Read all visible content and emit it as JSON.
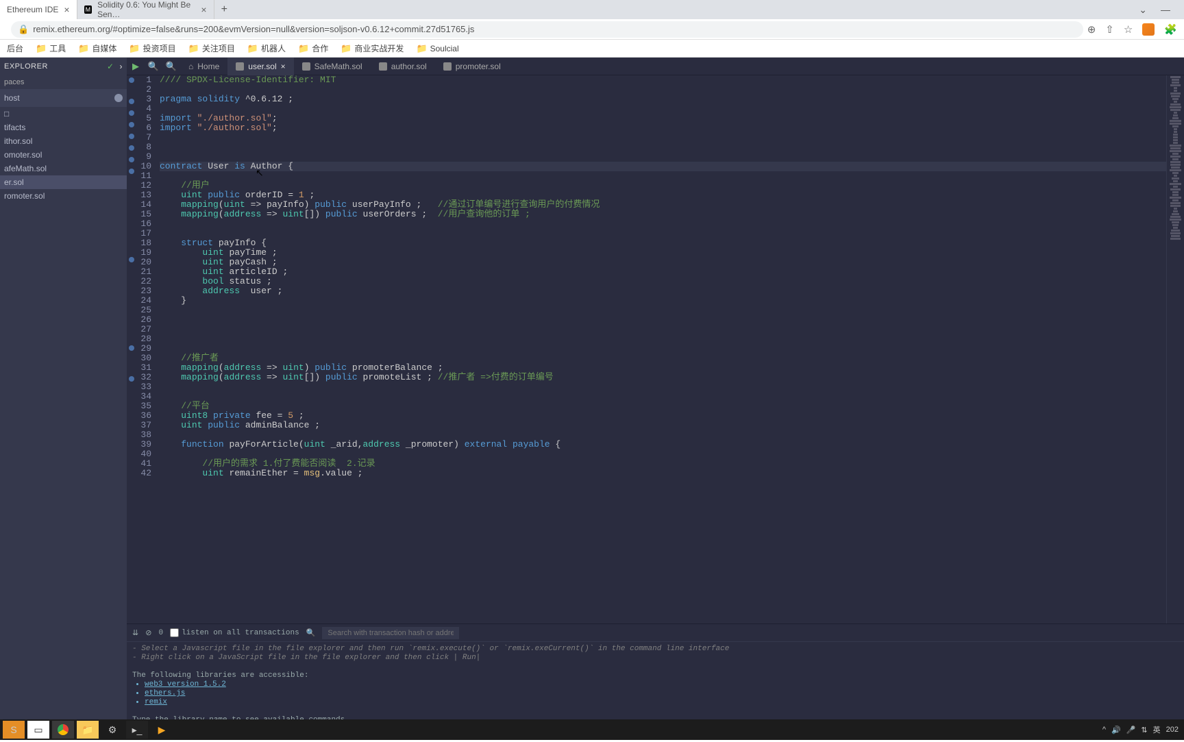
{
  "browser": {
    "tabs": [
      {
        "title": "Ethereum IDE",
        "active": true
      },
      {
        "title": "Solidity 0.6: You Might Be Sen…",
        "active": false
      }
    ],
    "url": "remix.ethereum.org/#optimize=false&runs=200&evmVersion=null&version=soljson-v0.6.12+commit.27d51765.js",
    "bookmarks": [
      "后台",
      "工具",
      "自媒体",
      "投资项目",
      "关注项目",
      "机器人",
      "合作",
      "商业实战开发",
      "Soulcial"
    ]
  },
  "sidebar": {
    "title": "EXPLORER",
    "workspaces": "paces",
    "host": "host",
    "files": [
      "□",
      "tifacts",
      "ithor.sol",
      "omoter.sol",
      "afeMath.sol",
      "er.sol",
      "romoter.sol"
    ],
    "selected_index": 5
  },
  "editor": {
    "tabs": [
      {
        "label": "Home",
        "icon": "home"
      },
      {
        "label": "user.sol",
        "icon": "sol",
        "active": true,
        "closable": true
      },
      {
        "label": "SafeMath.sol",
        "icon": "sol"
      },
      {
        "label": "author.sol",
        "icon": "sol"
      },
      {
        "label": "promoter.sol",
        "icon": "sol"
      }
    ],
    "breakpoints": [
      1,
      3,
      4,
      5,
      6,
      7,
      8,
      9,
      18,
      27,
      30
    ],
    "highlighted_line": 10
  },
  "code": [
    {
      "n": 1,
      "t": [
        [
          "cm",
          "//// SPDX-License-Identifier: MIT"
        ]
      ]
    },
    {
      "n": 2,
      "t": []
    },
    {
      "n": 3,
      "t": [
        [
          "kw",
          "pragma"
        ],
        [
          "",
          ""
        ],
        [
          "kw",
          " solidity"
        ],
        [
          "",
          " ^0.6.12 ;"
        ]
      ]
    },
    {
      "n": 4,
      "t": []
    },
    {
      "n": 5,
      "t": [
        [
          "kw",
          "import"
        ],
        [
          "",
          " "
        ],
        [
          "st",
          "\"./author.sol\""
        ],
        [
          "",
          ";"
        ]
      ]
    },
    {
      "n": 6,
      "t": [
        [
          "kw",
          "import"
        ],
        [
          "",
          " "
        ],
        [
          "st",
          "\"./author.sol\""
        ],
        [
          "",
          ";"
        ]
      ]
    },
    {
      "n": 7,
      "t": []
    },
    {
      "n": 8,
      "t": []
    },
    {
      "n": 9,
      "t": []
    },
    {
      "n": 10,
      "t": [
        [
          "kw",
          "contract"
        ],
        [
          "",
          " User "
        ],
        [
          "kw",
          "is"
        ],
        [
          "",
          " Author {"
        ]
      ]
    },
    {
      "n": 11,
      "t": []
    },
    {
      "n": 12,
      "t": [
        [
          "",
          "    "
        ],
        [
          "cm",
          "//用户"
        ]
      ]
    },
    {
      "n": 13,
      "t": [
        [
          "",
          "    "
        ],
        [
          "ty",
          "uint"
        ],
        [
          "",
          " "
        ],
        [
          "kw",
          "public"
        ],
        [
          "",
          " orderID = "
        ],
        [
          "nm",
          "1"
        ],
        [
          "",
          " ;"
        ]
      ]
    },
    {
      "n": 14,
      "t": [
        [
          "",
          "    "
        ],
        [
          "ty",
          "mapping"
        ],
        [
          "",
          "("
        ],
        [
          "ty",
          "uint"
        ],
        [
          "",
          " => payInfo) "
        ],
        [
          "kw",
          "public"
        ],
        [
          "",
          " userPayInfo ;   "
        ],
        [
          "cm",
          "//通过订单编号进行查询用户的付费情况"
        ]
      ]
    },
    {
      "n": 15,
      "t": [
        [
          "",
          "    "
        ],
        [
          "ty",
          "mapping"
        ],
        [
          "",
          "("
        ],
        [
          "ty",
          "address"
        ],
        [
          "",
          " => "
        ],
        [
          "ty",
          "uint"
        ],
        [
          "",
          "[]) "
        ],
        [
          "kw",
          "public"
        ],
        [
          "",
          " userOrders ;  "
        ],
        [
          "cm",
          "//用户查询他的订单 ;"
        ]
      ]
    },
    {
      "n": 16,
      "t": []
    },
    {
      "n": 17,
      "t": []
    },
    {
      "n": 18,
      "t": [
        [
          "",
          "    "
        ],
        [
          "kw",
          "struct"
        ],
        [
          "",
          " payInfo {"
        ]
      ]
    },
    {
      "n": 19,
      "t": [
        [
          "",
          "        "
        ],
        [
          "ty",
          "uint"
        ],
        [
          "",
          " payTime ;"
        ]
      ]
    },
    {
      "n": 20,
      "t": [
        [
          "",
          "        "
        ],
        [
          "ty",
          "uint"
        ],
        [
          "",
          " payCash ;"
        ]
      ]
    },
    {
      "n": 21,
      "t": [
        [
          "",
          "        "
        ],
        [
          "ty",
          "uint"
        ],
        [
          "",
          " articleID ;"
        ]
      ]
    },
    {
      "n": 22,
      "t": [
        [
          "",
          "        "
        ],
        [
          "ty",
          "bool"
        ],
        [
          "",
          " status ;"
        ]
      ]
    },
    {
      "n": 23,
      "t": [
        [
          "",
          "        "
        ],
        [
          "ty",
          "address"
        ],
        [
          "",
          "  user ;"
        ]
      ]
    },
    {
      "n": 24,
      "t": [
        [
          "",
          "    }"
        ]
      ]
    },
    {
      "n": 25,
      "t": []
    },
    {
      "n": 26,
      "t": []
    },
    {
      "n": 27,
      "t": []
    },
    {
      "n": 28,
      "t": []
    },
    {
      "n": 29,
      "t": []
    },
    {
      "n": 30,
      "t": [
        [
          "",
          "    "
        ],
        [
          "cm",
          "//推广者"
        ]
      ]
    },
    {
      "n": 31,
      "t": [
        [
          "",
          "    "
        ],
        [
          "ty",
          "mapping"
        ],
        [
          "",
          "("
        ],
        [
          "ty",
          "address"
        ],
        [
          "",
          " => "
        ],
        [
          "ty",
          "uint"
        ],
        [
          "",
          ") "
        ],
        [
          "kw",
          "public"
        ],
        [
          "",
          " promoterBalance ;"
        ]
      ]
    },
    {
      "n": 32,
      "t": [
        [
          "",
          "    "
        ],
        [
          "ty",
          "mapping"
        ],
        [
          "",
          "("
        ],
        [
          "ty",
          "address"
        ],
        [
          "",
          " => "
        ],
        [
          "ty",
          "uint"
        ],
        [
          "",
          "[]) "
        ],
        [
          "kw",
          "public"
        ],
        [
          "",
          " promoteList ; "
        ],
        [
          "cm",
          "//推广者 =>付费的订单编号"
        ]
      ]
    },
    {
      "n": 33,
      "t": []
    },
    {
      "n": 34,
      "t": []
    },
    {
      "n": 35,
      "t": [
        [
          "",
          "    "
        ],
        [
          "cm",
          "//平台"
        ]
      ]
    },
    {
      "n": 36,
      "t": [
        [
          "",
          "    "
        ],
        [
          "ty",
          "uint8"
        ],
        [
          "",
          " "
        ],
        [
          "kw",
          "private"
        ],
        [
          "",
          " fee = "
        ],
        [
          "nm",
          "5"
        ],
        [
          "",
          " ;"
        ]
      ]
    },
    {
      "n": 37,
      "t": [
        [
          "",
          "    "
        ],
        [
          "ty",
          "uint"
        ],
        [
          "",
          " "
        ],
        [
          "kw",
          "public"
        ],
        [
          "",
          " adminBalance ;"
        ]
      ]
    },
    {
      "n": 38,
      "t": []
    },
    {
      "n": 39,
      "t": [
        [
          "",
          "    "
        ],
        [
          "kw",
          "function"
        ],
        [
          "",
          " payForArticle("
        ],
        [
          "ty",
          "uint"
        ],
        [
          "",
          " _arid,"
        ],
        [
          "ty",
          "address"
        ],
        [
          "",
          " _promoter) "
        ],
        [
          "kw",
          "external"
        ],
        [
          "",
          " "
        ],
        [
          "kw",
          "payable"
        ],
        [
          "",
          " {"
        ]
      ]
    },
    {
      "n": 40,
      "t": []
    },
    {
      "n": 41,
      "t": [
        [
          "",
          "        "
        ],
        [
          "cm",
          "//用户的需求 1.付了费能否阅读  2.记录"
        ]
      ]
    },
    {
      "n": 42,
      "t": [
        [
          "",
          "        "
        ],
        [
          "ty",
          "uint"
        ],
        [
          "",
          " remainEther = "
        ],
        [
          "id",
          "msg"
        ],
        [
          "",
          ".value ;"
        ]
      ]
    }
  ],
  "terminal": {
    "count": "0",
    "listen_label": "listen on all transactions",
    "search_placeholder": "Search with transaction hash or address",
    "lines": [
      "- Select a Javascript file in the file explorer and then run `remix.execute()` or `remix.exeCurrent()`  in the command line interface",
      "- Right click on a JavaScript file in the file explorer and then click | Run|"
    ],
    "libs_header": "The following libraries are accessible:",
    "libs": [
      "web3 version 1.5.2",
      "ethers.js",
      "remix"
    ],
    "footer": "Type the library name to see available commands.",
    "prompt": ">"
  },
  "taskbar": {
    "right": [
      "🔊",
      "英",
      "202"
    ]
  }
}
